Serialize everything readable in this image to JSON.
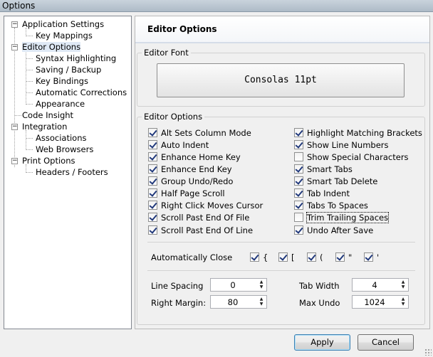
{
  "window": {
    "title": "Options"
  },
  "tree": {
    "items": [
      {
        "label": "Application Settings",
        "level": 0,
        "expander": "−"
      },
      {
        "label": "Key Mappings",
        "level": 1
      },
      {
        "label": "Editor Options",
        "level": 0,
        "expander": "−",
        "selected": true
      },
      {
        "label": "Syntax Highlighting",
        "level": 1
      },
      {
        "label": "Saving / Backup",
        "level": 1
      },
      {
        "label": "Key Bindings",
        "level": 1
      },
      {
        "label": "Automatic Corrections",
        "level": 1
      },
      {
        "label": "Appearance",
        "level": 1
      },
      {
        "label": "Code Insight",
        "level": 0
      },
      {
        "label": "Integration",
        "level": 0,
        "expander": "−"
      },
      {
        "label": "Associations",
        "level": 1
      },
      {
        "label": "Web Browsers",
        "level": 1
      },
      {
        "label": "Print Options",
        "level": 0,
        "expander": "−"
      },
      {
        "label": "Headers / Footers",
        "level": 1
      }
    ]
  },
  "panel": {
    "header": "Editor Options",
    "font_group": {
      "legend": "Editor Font",
      "font_button": "Consolas 11pt"
    },
    "options_group": {
      "legend": "Editor Options",
      "left": [
        {
          "label": "Alt Sets Column Mode",
          "checked": true
        },
        {
          "label": "Auto Indent",
          "checked": true
        },
        {
          "label": "Enhance Home Key",
          "checked": true
        },
        {
          "label": "Enhance End Key",
          "checked": true
        },
        {
          "label": "Group Undo/Redo",
          "checked": true
        },
        {
          "label": "Half Page Scroll",
          "checked": true
        },
        {
          "label": "Right Click Moves Cursor",
          "checked": true
        },
        {
          "label": "Scroll Past End Of File",
          "checked": true
        },
        {
          "label": "Scroll Past End Of Line",
          "checked": true
        }
      ],
      "right": [
        {
          "label": "Highlight Matching Brackets",
          "checked": true
        },
        {
          "label": "Show Line Numbers",
          "checked": true
        },
        {
          "label": "Show Special Characters",
          "checked": false
        },
        {
          "label": "Smart Tabs",
          "checked": true
        },
        {
          "label": "Smart Tab Delete",
          "checked": true
        },
        {
          "label": "Tab Indent",
          "checked": true
        },
        {
          "label": "Tabs To Spaces",
          "checked": true
        },
        {
          "label": "Trim Trailing Spaces",
          "checked": false,
          "focused": true
        },
        {
          "label": "Undo After Save",
          "checked": true
        }
      ],
      "auto_close": {
        "label": "Automatically Close",
        "items": [
          {
            "label": "{",
            "checked": true
          },
          {
            "label": "[",
            "checked": true
          },
          {
            "label": "(",
            "checked": true
          },
          {
            "label": "\"",
            "checked": true
          },
          {
            "label": "'",
            "checked": true
          }
        ]
      },
      "line_spacing": {
        "label": "Line Spacing",
        "value": "0"
      },
      "tab_width": {
        "label": "Tab Width",
        "value": "4"
      },
      "right_margin": {
        "label": "Right Margin:",
        "value": "80"
      },
      "max_undo": {
        "label": "Max Undo",
        "value": "1024"
      }
    }
  },
  "buttons": {
    "apply": "Apply",
    "cancel": "Cancel"
  }
}
